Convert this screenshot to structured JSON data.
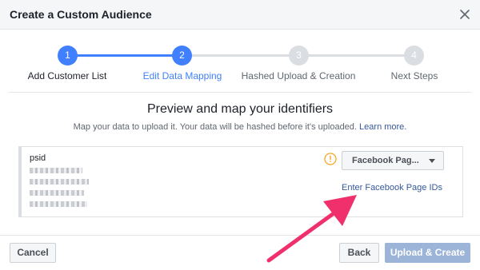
{
  "dialog": {
    "title": "Create a Custom Audience"
  },
  "stepper": {
    "steps": [
      {
        "number": "1",
        "label": "Add Customer List"
      },
      {
        "number": "2",
        "label": "Edit Data Mapping"
      },
      {
        "number": "3",
        "label": "Hashed Upload & Creation"
      },
      {
        "number": "4",
        "label": "Next Steps"
      }
    ],
    "current_step": 2
  },
  "main": {
    "heading": "Preview and map your identifiers",
    "subtext": "Map your data to upload it. Your data will be hashed before it's uploaded.",
    "learn_more": "Learn more."
  },
  "mapping": {
    "column_header": "psid",
    "identifier_select": "Facebook Pag...",
    "page_ids_link": "Enter Facebook Page IDs",
    "warning_icon": "exclamation-circle-icon"
  },
  "footer": {
    "cancel": "Cancel",
    "back": "Back",
    "upload_create": "Upload & Create"
  },
  "colors": {
    "accent": "#4080ff",
    "link": "#365899",
    "warning": "#f5a623",
    "annotation_arrow": "#f0306c",
    "disabled_primary": "#9cb4d8"
  }
}
